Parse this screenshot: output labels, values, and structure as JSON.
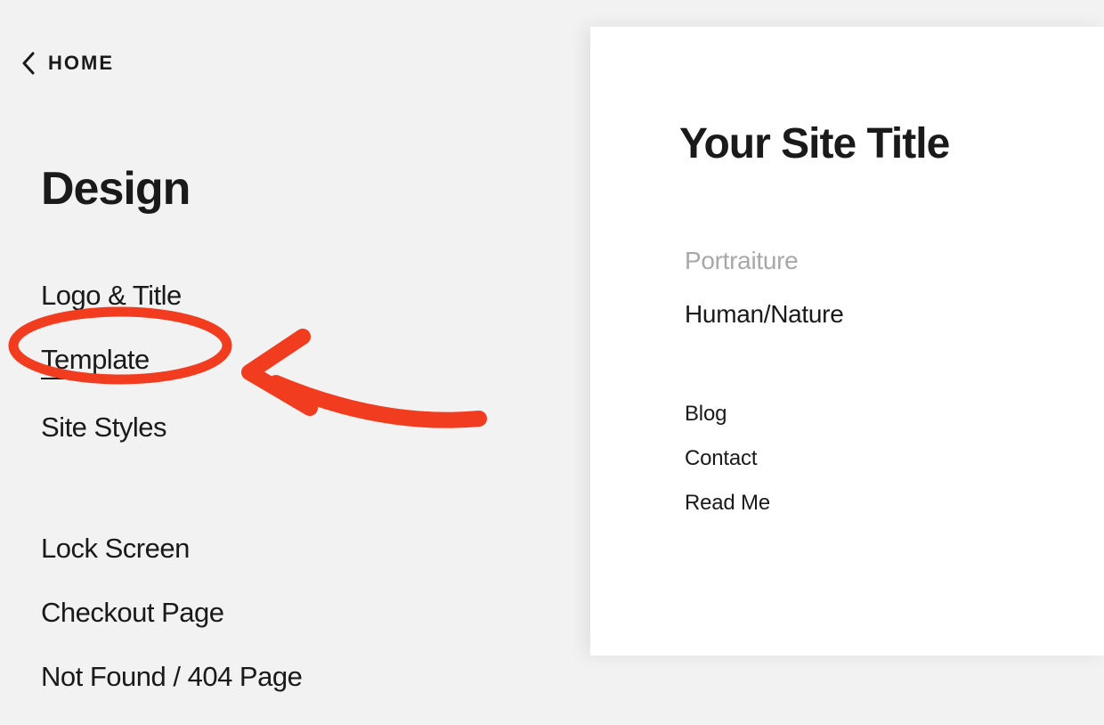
{
  "sidebar": {
    "back_label": "HOME",
    "section_title": "Design",
    "group1": [
      {
        "label": "Logo & Title"
      },
      {
        "label": "Template"
      },
      {
        "label": "Site Styles"
      }
    ],
    "group2": [
      {
        "label": "Lock Screen"
      },
      {
        "label": "Checkout Page"
      },
      {
        "label": "Not Found / 404 Page"
      }
    ]
  },
  "preview": {
    "site_title": "Your Site Title",
    "nav_primary": [
      {
        "label": "Portraiture",
        "muted": true
      },
      {
        "label": "Human/Nature",
        "muted": false
      }
    ],
    "nav_secondary": [
      {
        "label": "Blog"
      },
      {
        "label": "Contact"
      },
      {
        "label": "Read Me"
      }
    ]
  },
  "annotation": {
    "color": "#f13c1f"
  }
}
